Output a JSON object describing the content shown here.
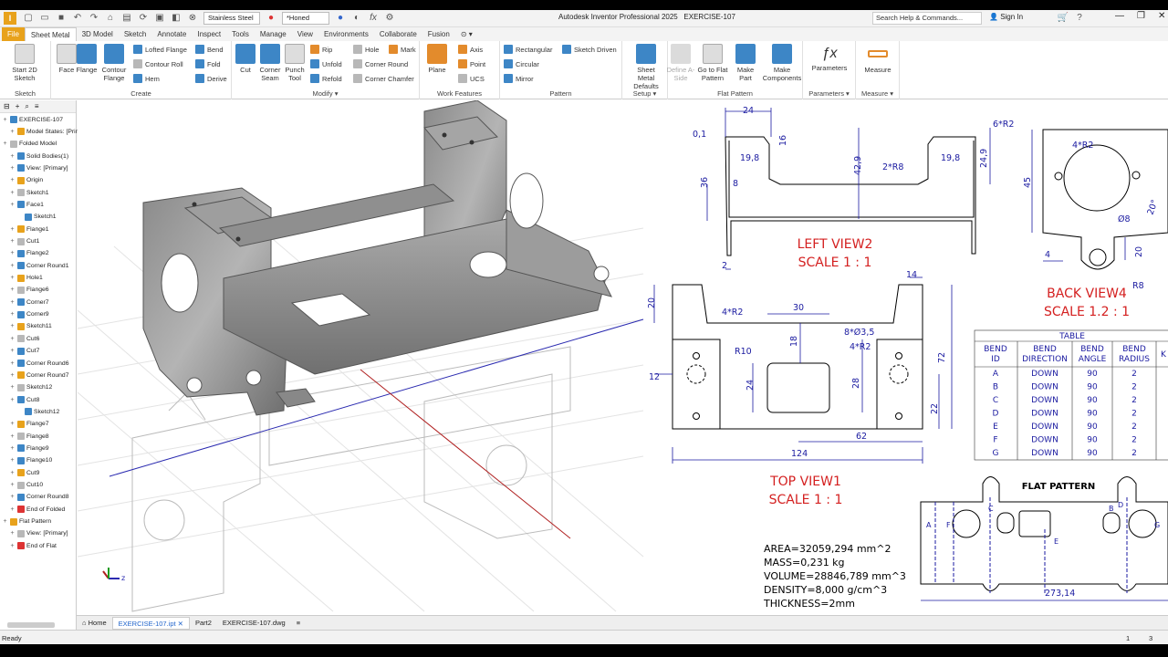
{
  "app": {
    "title": "Autodesk Inventor Professional 2025",
    "document": "EXERCISE-107",
    "material": "Stainless Steel",
    "appearance": "*Honed",
    "search_placeholder": "Search Help & Commands...",
    "signin": "Sign In"
  },
  "tabs": [
    "File",
    "Sheet Metal",
    "3D Model",
    "Sketch",
    "Annotate",
    "Inspect",
    "Tools",
    "Manage",
    "View",
    "Environments",
    "Collaborate",
    "Fusion"
  ],
  "active_tab": "Sheet Metal",
  "ribbon": {
    "sketch": {
      "title": "Sketch",
      "start": "Start 2D Sketch"
    },
    "create": {
      "title": "Create",
      "face": "Face",
      "flange": "Flange",
      "contour_flange": "Contour Flange",
      "lofted_flange": "Lofted Flange",
      "contour_roll": "Contour Roll",
      "hem": "Hem",
      "bend": "Bend",
      "fold": "Fold",
      "derive": "Derive"
    },
    "modify": {
      "title": "Modify",
      "cut": "Cut",
      "corner_seam": "Corner Seam",
      "punch_tool": "Punch Tool",
      "rip": "Rip",
      "unfold": "Unfold",
      "refold": "Refold",
      "hole": "Hole",
      "corner_round": "Corner Round",
      "corner_chamfer": "Corner Chamfer",
      "mark": "Mark"
    },
    "work_features": {
      "title": "Work Features",
      "plane": "Plane",
      "axis": "Axis",
      "point": "Point",
      "ucs": "UCS"
    },
    "pattern": {
      "title": "Pattern",
      "rectangular": "Rectangular",
      "circular": "Circular",
      "mirror": "Mirror",
      "sketch_driven": "Sketch Driven"
    },
    "setup": {
      "title": "Setup",
      "defaults": "Sheet Metal Defaults"
    },
    "flat_pattern": {
      "title": "Flat Pattern",
      "define_aside": "Define A-Side",
      "goto": "Go to Flat Pattern",
      "make_part": "Make Part",
      "make_components": "Make Components"
    },
    "parameters": {
      "title": "Parameters",
      "label": "Parameters"
    },
    "measure": {
      "title": "Measure",
      "label": "Measure"
    }
  },
  "browser": {
    "items": [
      {
        "label": "EXERCISE-107",
        "level": 0
      },
      {
        "label": "Model States: [Prim",
        "level": 1
      },
      {
        "label": "Folded Model",
        "level": 0
      },
      {
        "label": "Solid Bodies(1)",
        "level": 1
      },
      {
        "label": "View: [Primary]",
        "level": 1
      },
      {
        "label": "Origin",
        "level": 1
      },
      {
        "label": "Sketch1",
        "level": 1
      },
      {
        "label": "Face1",
        "level": 1
      },
      {
        "label": "Sketch1",
        "level": 2
      },
      {
        "label": "Flange1",
        "level": 1
      },
      {
        "label": "Cut1",
        "level": 1
      },
      {
        "label": "Flange2",
        "level": 1
      },
      {
        "label": "Corner Round1",
        "level": 1
      },
      {
        "label": "Hole1",
        "level": 1
      },
      {
        "label": "Flange6",
        "level": 1
      },
      {
        "label": "Corner7",
        "level": 1
      },
      {
        "label": "Corner9",
        "level": 1
      },
      {
        "label": "Sketch11",
        "level": 1
      },
      {
        "label": "Cut6",
        "level": 1
      },
      {
        "label": "Cut7",
        "level": 1
      },
      {
        "label": "Corner Round6",
        "level": 1
      },
      {
        "label": "Corner Round7",
        "level": 1
      },
      {
        "label": "Sketch12",
        "level": 1
      },
      {
        "label": "Cut8",
        "level": 1
      },
      {
        "label": "Sketch12",
        "level": 2
      },
      {
        "label": "Flange7",
        "level": 1
      },
      {
        "label": "Flange8",
        "level": 1
      },
      {
        "label": "Flange9",
        "level": 1
      },
      {
        "label": "Flange10",
        "level": 1
      },
      {
        "label": "Cut9",
        "level": 1
      },
      {
        "label": "Cut10",
        "level": 1
      },
      {
        "label": "Corner Round8",
        "level": 1
      },
      {
        "label": "End of Folded",
        "level": 1
      },
      {
        "label": "Flat Pattern",
        "level": 0
      },
      {
        "label": "View: [Primary]",
        "level": 1
      },
      {
        "label": "End of Flat",
        "level": 1
      }
    ]
  },
  "drawing": {
    "left_view": {
      "title": "LEFT VIEW2",
      "scale": "SCALE 1 : 1"
    },
    "back_view": {
      "title": "BACK VIEW4",
      "scale": "SCALE 1.2 : 1"
    },
    "top_view": {
      "title": "TOP VIEW1",
      "scale": "SCALE 1 : 1"
    },
    "flat_title": "FLAT PATTERN",
    "dims": {
      "d24": "24",
      "d6r2": "6*R2",
      "d01": "0,1",
      "d16": "16",
      "d198a": "19,8",
      "d429": "42,9",
      "d198b": "19,8",
      "d249": "24,9",
      "d2r8": "2*R8",
      "d36": "36",
      "d8": "8",
      "d2": "2",
      "d4r2_back": "4*R2",
      "d45": "45",
      "d20deg": "20°",
      "d8dia": "Ø8",
      "d4": "4",
      "d20": "20",
      "r8": "R8",
      "d14": "14",
      "d20top": "20",
      "d4r2a": "4*R2",
      "d30": "30",
      "d8holes": "8*Ø3,5",
      "d4r2b": "4*R2",
      "d72": "72",
      "r10": "R10",
      "d18": "18",
      "d12": "12",
      "d24top": "24",
      "d28": "28",
      "d22": "22",
      "d62": "62",
      "d124": "124",
      "d27314": "273,14"
    },
    "flat_letters": [
      "A",
      "F",
      "C",
      "B",
      "D",
      "E",
      "G"
    ],
    "properties": [
      "AREA=32059,294 mm^2",
      "MASS=0,231 kg",
      "VOLUME=28846,789 mm^3",
      "DENSITY=8,000 g/cm^3",
      "THICKNESS=2mm"
    ],
    "table": {
      "title": "TABLE",
      "headers": [
        "BEND ID",
        "BEND DIRECTION",
        "BEND ANGLE",
        "BEND RADIUS",
        "K"
      ],
      "rows": [
        [
          "A",
          "DOWN",
          "90",
          "2"
        ],
        [
          "B",
          "DOWN",
          "90",
          "2"
        ],
        [
          "C",
          "DOWN",
          "90",
          "2"
        ],
        [
          "D",
          "DOWN",
          "90",
          "2"
        ],
        [
          "E",
          "DOWN",
          "90",
          "2"
        ],
        [
          "F",
          "DOWN",
          "90",
          "2"
        ],
        [
          "G",
          "DOWN",
          "90",
          "2"
        ]
      ]
    }
  },
  "doc_tabs": [
    "Home",
    "EXERCISE-107.ipt",
    "Part2",
    "EXERCISE-107.dwg"
  ],
  "status": {
    "left": "Ready",
    "n1": "1",
    "n2": "3"
  },
  "colors": {
    "accent": "#e8a21c",
    "dim": "#1a1aa0",
    "title_red": "#d42020",
    "selection_blue": "#3d86c6"
  }
}
